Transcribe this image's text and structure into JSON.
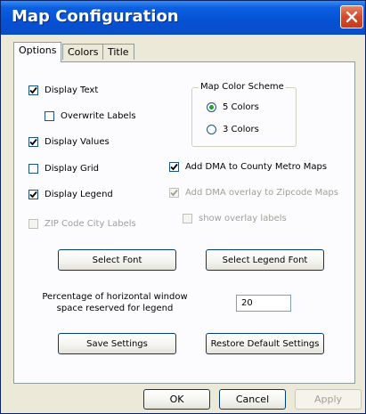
{
  "window": {
    "title": "Map Configuration"
  },
  "tabs": [
    {
      "label": "Options",
      "active": true
    },
    {
      "label": "Colors",
      "active": false
    },
    {
      "label": "Title",
      "active": false
    }
  ],
  "options": {
    "display_text": {
      "label": "Display Text",
      "checked": true
    },
    "overwrite_labels": {
      "label": "Overwrite Labels",
      "checked": false
    },
    "display_values": {
      "label": "Display  Values",
      "checked": true
    },
    "display_grid": {
      "label": "Display Grid",
      "checked": false
    },
    "display_legend": {
      "label": "Display Legend",
      "checked": true
    },
    "zip_city_labels": {
      "label": "ZIP Code City Labels",
      "checked": false,
      "disabled": true
    },
    "add_dma_county": {
      "label": "Add DMA to County Metro Maps",
      "checked": true
    },
    "add_dma_zip": {
      "label": "Add DMA overlay to Zipcode Maps",
      "checked": true,
      "disabled": true
    },
    "show_overlay_labels": {
      "label": "show overlay labels",
      "checked": false,
      "disabled": true
    }
  },
  "color_scheme": {
    "title": "Map Color Scheme",
    "options": [
      {
        "label": "5 Colors",
        "selected": true
      },
      {
        "label": "3 Colors",
        "selected": false
      }
    ]
  },
  "buttons": {
    "select_font": "Select Font",
    "select_legend_font": "Select Legend Font",
    "save_settings": "Save Settings",
    "restore_defaults": "Restore Default Settings"
  },
  "legend_space": {
    "label": "Percentage of horizontal window space reserved for legend",
    "value": "20"
  },
  "dialog_buttons": {
    "ok": "OK",
    "cancel": "Cancel",
    "apply": "Apply"
  },
  "colors": {
    "titlebar": "#0551d3",
    "close": "#d3492b",
    "radio_dot": "#21a121",
    "dialog_bg": "#ece9d8"
  }
}
